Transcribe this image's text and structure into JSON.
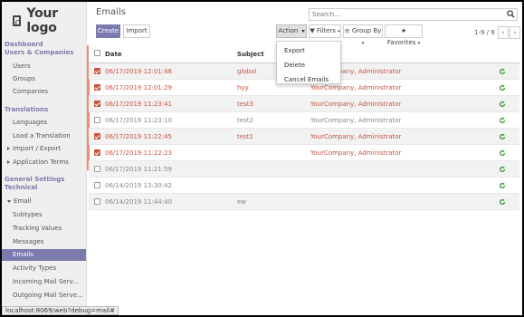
{
  "logo_text": "Your logo",
  "sidebar": {
    "sections": [
      {
        "title": "Dashboard",
        "key": "dashboard"
      },
      {
        "title": "Users & Companies",
        "key": "users"
      },
      {
        "title": "Translations",
        "key": "translations"
      },
      {
        "title": "General Settings",
        "key": "general"
      },
      {
        "title": "Technical",
        "key": "technical"
      }
    ],
    "items": [
      {
        "label": "Users"
      },
      {
        "label": "Groups"
      },
      {
        "label": "Companies"
      },
      {
        "label": "Languages"
      },
      {
        "label": "Load a Translation"
      },
      {
        "label": "Import / Export"
      },
      {
        "label": "Application Terms"
      },
      {
        "label": "Email"
      },
      {
        "label": "Subtypes"
      },
      {
        "label": "Tracking Values"
      },
      {
        "label": "Messages"
      },
      {
        "label": "Emails"
      },
      {
        "label": "Activity Types"
      },
      {
        "label": "Incoming Mail Serv..."
      },
      {
        "label": "Outgoing Mail Serve..."
      }
    ]
  },
  "page_title": "Emails",
  "search": {
    "placeholder": "Search..."
  },
  "buttons": {
    "create": "Create",
    "import": "Import",
    "action": "Action",
    "filters": "Filters",
    "group_by": "Group By",
    "favorites": "Favorites"
  },
  "pager": {
    "text": "1-9 / 9"
  },
  "action_menu": [
    "Export",
    "Delete",
    "Cancel Emails"
  ],
  "table": {
    "columns": [
      "Date",
      "Subject"
    ],
    "rows": [
      {
        "date": "06/17/2019 12:01:48",
        "subject": "global",
        "author": "YourCompany, Administrator",
        "checked": true,
        "style": "red",
        "retry": true
      },
      {
        "date": "06/17/2019 12:01:29",
        "subject": "hyy",
        "author": "YourCompany, Administrator",
        "checked": true,
        "style": "red",
        "retry": true
      },
      {
        "date": "06/17/2019 11:23:41",
        "subject": "test3",
        "author": "YourCompany, Administrator",
        "checked": true,
        "style": "red",
        "retry": true
      },
      {
        "date": "06/17/2019 11:23:10",
        "subject": "test2",
        "author": "YourCompany, Administrator",
        "checked": false,
        "style": "grey",
        "retry": true
      },
      {
        "date": "06/17/2019 11:22:45",
        "subject": "test1",
        "author": "YourCompany, Administrator",
        "checked": true,
        "style": "red",
        "retry": true
      },
      {
        "date": "06/17/2019 11:22:23",
        "subject": "",
        "author": "YourCompany, Administrator",
        "checked": true,
        "style": "red",
        "retry": true
      },
      {
        "date": "06/17/2019 11:21:59",
        "subject": "",
        "author": "",
        "checked": false,
        "style": "grey",
        "retry": true
      },
      {
        "date": "06/14/2019 13:30:42",
        "subject": "",
        "author": "",
        "checked": false,
        "style": "grey",
        "retry": true
      },
      {
        "date": "06/14/2019 11:44:40",
        "subject": "ew",
        "author": "",
        "checked": false,
        "style": "grey",
        "retry": true
      }
    ]
  },
  "status_url": "localhost:8069/web?debug=mail#",
  "colors": {
    "accent": "#7c7bad",
    "error": "#c8543e",
    "retry": "#3a9a3a"
  }
}
